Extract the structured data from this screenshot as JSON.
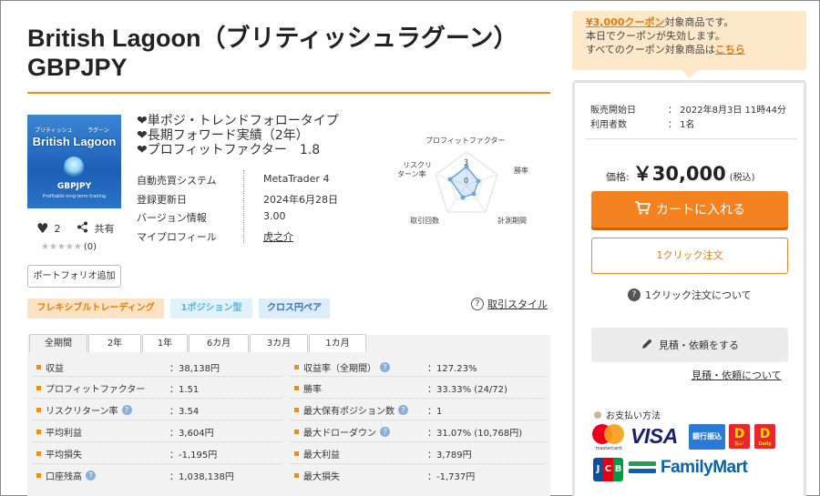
{
  "title": {
    "line1": "British Lagoon（ブリティッシュラグーン）",
    "line2": "GBPJPY"
  },
  "product_image": {
    "small_left": "ブリティッシュ",
    "small_right": "ラグーン",
    "main": "British Lagoon",
    "pair": "GBPJPY",
    "subtitle": "Profitable long-term trading"
  },
  "likes": {
    "count": "2",
    "share_label": "共有"
  },
  "rating": {
    "stars": "★★★★★",
    "count": "(0)"
  },
  "portfolio_button": "ポートフォリオ追加",
  "features": [
    "❤単ポジ・トレンドフォロータイプ",
    "❤長期フォワード実績（2年）",
    "❤プロフィットファクター　1.8"
  ],
  "info": [
    {
      "label": "自動売買システム",
      "value": "MetaTrader 4"
    },
    {
      "label": "登録更新日",
      "value": "2024年6月28日"
    },
    {
      "label": "バージョン情報",
      "value": "3.00"
    },
    {
      "label": "マイプロフィール",
      "value": "虎之介"
    }
  ],
  "radar": {
    "labels": [
      "プロフィットファクター",
      "勝率",
      "計測期間",
      "取引回数",
      "リスクリ",
      "ターン率"
    ],
    "tick_3": "3",
    "tick_0": "0"
  },
  "tags": [
    "フレキシブルトレーディング",
    "1ポジション型",
    "クロス円ペア"
  ],
  "style_link": "取引スタイル",
  "tabs": [
    "全期間",
    "2年",
    "1年",
    "6カ月",
    "3カ月",
    "1カ月"
  ],
  "stats_left": [
    {
      "label": "収益",
      "value": "：38,138円",
      "help": false
    },
    {
      "label": "プロフィットファクター",
      "value": "：1.51",
      "help": false
    },
    {
      "label": "リスクリターン率",
      "value": "：3.54",
      "help": true
    },
    {
      "label": "平均利益",
      "value": "：3,604円",
      "help": false
    },
    {
      "label": "平均損失",
      "value": "：-1,195円",
      "help": false
    },
    {
      "label": "口座残高",
      "value": "：1,038,138円",
      "help": true
    }
  ],
  "stats_right": [
    {
      "label": "収益率（全期間）",
      "value": "：127.23%",
      "help": true
    },
    {
      "label": "勝率",
      "value": "：33.33% (24/72)",
      "help": false
    },
    {
      "label": "最大保有ポジション数",
      "value": "：1",
      "help": true
    },
    {
      "label": "最大ドローダウン",
      "value": "：31.07% (10,768円)",
      "help": true
    },
    {
      "label": "最大利益",
      "value": "：3,789円",
      "help": false
    },
    {
      "label": "最大損失",
      "value": "：-1,737円",
      "help": false
    }
  ],
  "coupon": {
    "highlight": "¥3,000クーポン",
    "line1_suffix": "対象商品です。",
    "line2": "本日でクーポンが失効します。",
    "line3_prefix": "すべてのクーポン対象商品は",
    "line3_link": "こちら"
  },
  "meta": [
    {
      "k": "販売開始日",
      "v": "：  2022年8月3日 11時44分"
    },
    {
      "k": "利用者数",
      "v": "：  1名"
    }
  ],
  "price": {
    "label": "価格:",
    "amount": "￥30,000",
    "tax": "(税込)"
  },
  "cart_button": "カートに入れる",
  "oneclick_button": "1クリック注文",
  "oneclick_about": "1クリック注文について",
  "quote_button": "見積・依頼をする",
  "quote_link": "見積・依頼について",
  "payment": {
    "title": "お支払い方法",
    "mastercard": "mastercard",
    "visa": "VISA",
    "bank": "銀行振込",
    "d1": "D",
    "d1_sub": "払い",
    "d2": "D",
    "d2_sub": "Daily",
    "jcb": [
      "J",
      "C",
      "B"
    ],
    "familymart": "FamilyMart"
  },
  "colors": {
    "accent": "#f58220",
    "rule": "#f08c1e",
    "coupon_bg": "#fde8c9"
  },
  "icons": [
    "heart-icon",
    "share-icon",
    "question-circle-icon",
    "cart-icon",
    "pencil-icon"
  ]
}
